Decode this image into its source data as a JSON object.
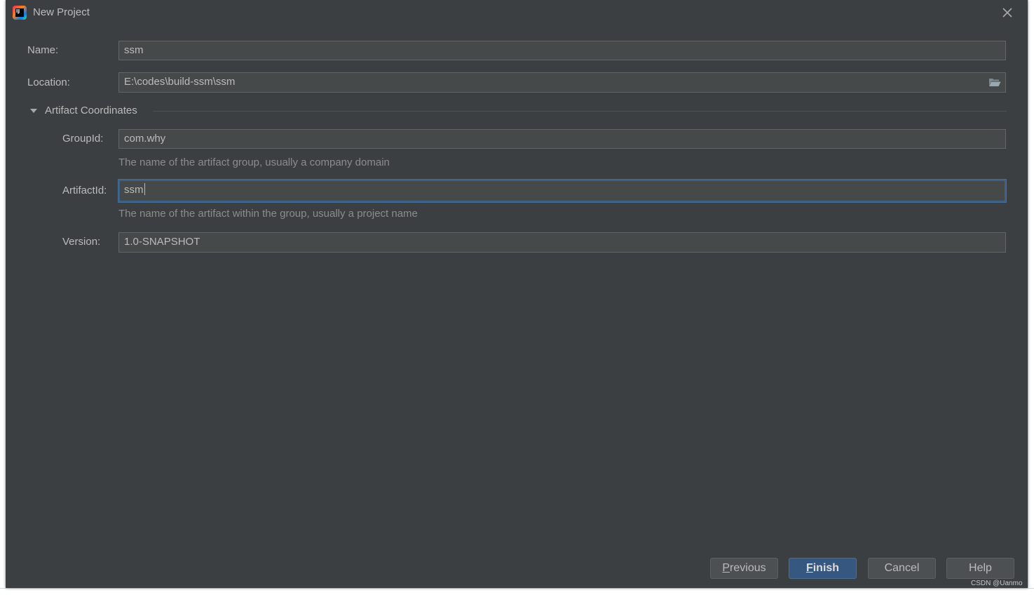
{
  "window": {
    "title": "New Project"
  },
  "form": {
    "name": {
      "label": "Name:",
      "value": "ssm"
    },
    "location": {
      "label": "Location:",
      "value": "E:\\codes\\build-ssm\\ssm"
    },
    "section": {
      "title": "Artifact Coordinates",
      "expanded": true
    },
    "group_id": {
      "label": "GroupId:",
      "value": "com.why",
      "hint": "The name of the artifact group, usually a company domain"
    },
    "artifact_id": {
      "label": "ArtifactId:",
      "value": "ssm",
      "hint": "The name of the artifact within the group, usually a project name"
    },
    "version": {
      "label": "Version:",
      "value": "1.0-SNAPSHOT"
    }
  },
  "buttons": {
    "previous": {
      "mnemonic": "P",
      "rest": "revious"
    },
    "finish": {
      "mnemonic": "F",
      "rest": "inish"
    },
    "cancel": "Cancel",
    "help": "Help"
  },
  "watermark": "CSDN @Uanmo",
  "colors": {
    "background": "#3c3f41",
    "field_bg": "#45494a",
    "focus_border": "#3d6185",
    "primary_button": "#365880"
  }
}
